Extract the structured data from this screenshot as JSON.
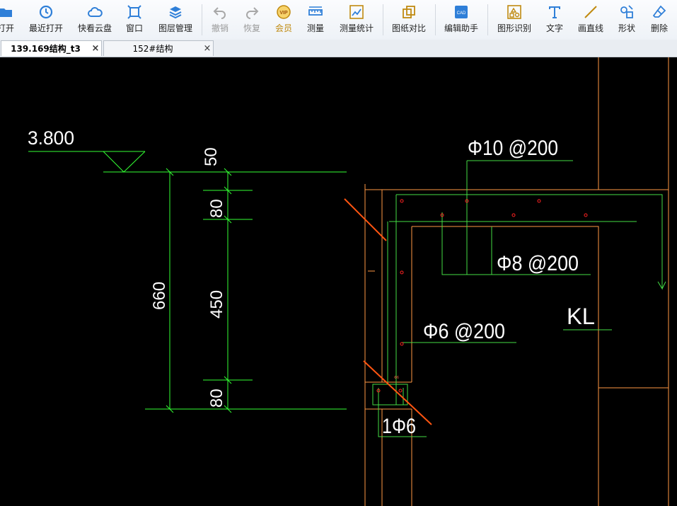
{
  "toolbar": {
    "items": [
      {
        "label": "打开",
        "icon": "folder-open-icon"
      },
      {
        "label": "最近打开",
        "icon": "clock-history-icon"
      },
      {
        "label": "快看云盘",
        "icon": "cloud-icon"
      },
      {
        "label": "窗口",
        "icon": "window-icon"
      },
      {
        "label": "图层管理",
        "icon": "layers-icon"
      },
      {
        "label": "撤销",
        "icon": "undo-icon"
      },
      {
        "label": "恢复",
        "icon": "redo-icon"
      },
      {
        "label": "会员",
        "icon": "vip-icon"
      },
      {
        "label": "测量",
        "icon": "ruler-icon"
      },
      {
        "label": "测量统计",
        "icon": "measure-stats-icon"
      },
      {
        "label": "图纸对比",
        "icon": "compare-icon"
      },
      {
        "label": "编辑助手",
        "icon": "edit-assistant-icon"
      },
      {
        "label": "图形识别",
        "icon": "shape-recognition-icon"
      },
      {
        "label": "文字",
        "icon": "text-icon"
      },
      {
        "label": "画直线",
        "icon": "line-icon"
      },
      {
        "label": "形状",
        "icon": "shapes-icon"
      },
      {
        "label": "删除",
        "icon": "eraser-icon"
      }
    ]
  },
  "tabs": [
    {
      "title": "139.169结构_t3",
      "active": true
    },
    {
      "title": "152#结构",
      "active": false
    }
  ],
  "tab_close_glyph": "×",
  "drawing": {
    "elevation": "3.800",
    "dims": [
      "50",
      "80",
      "450",
      "80",
      "660"
    ],
    "rebar_labels": [
      "Φ10 @200",
      "Φ8 @200",
      "Φ6 @200",
      "1Φ6"
    ],
    "beam_label": "KL",
    "small_label": "Φ6"
  },
  "colors": {
    "dimension_green": "#33ff33",
    "rebar_green": "#44dd44",
    "outline_orange": "#ff9944",
    "cut_orange": "#ff5511",
    "text_white": "#ffffff",
    "rebar_dot_red": "#ff2222",
    "vip_gold": "#c08a10"
  }
}
